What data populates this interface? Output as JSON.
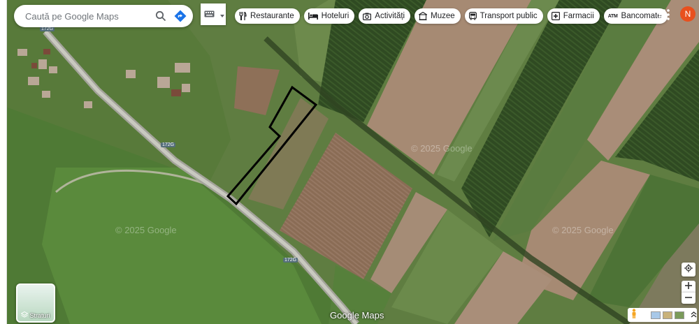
{
  "search": {
    "placeholder": "Caută pe Google Maps"
  },
  "chips": [
    {
      "label": "Restaurante",
      "icon": "fork-knife-icon"
    },
    {
      "label": "Hoteluri",
      "icon": "bed-icon"
    },
    {
      "label": "Activități",
      "icon": "camera-icon"
    },
    {
      "label": "Muzee",
      "icon": "museum-icon"
    },
    {
      "label": "Transport public",
      "icon": "bus-icon"
    },
    {
      "label": "Farmacii",
      "icon": "pharmacy-icon"
    },
    {
      "label": "Bancomate",
      "icon": "atm-icon"
    }
  ],
  "account": {
    "initial": "N",
    "color": "#e8501e"
  },
  "road_labels": [
    "172G",
    "172G",
    "172G"
  ],
  "watermarks": [
    "© 2025 Google",
    "© 2025 Google",
    "© 2025 Google"
  ],
  "layers_label": "Straturi",
  "brand": "Google Maps",
  "parcel_outline_color": "#000000"
}
